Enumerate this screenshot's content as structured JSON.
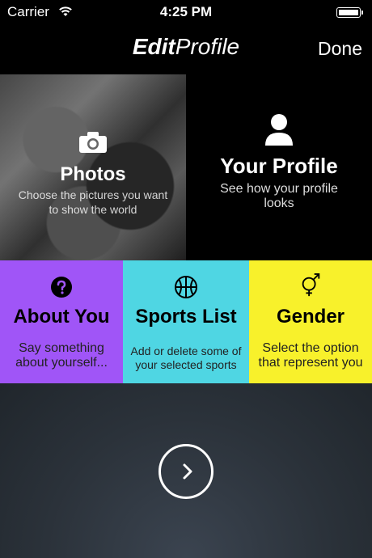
{
  "status_bar": {
    "carrier": "Carrier",
    "time": "4:25 PM",
    "wifi_icon": "wifi-icon",
    "battery_icon": "battery-icon"
  },
  "nav": {
    "title_bold": "Edit",
    "title_light": "Profile",
    "done_label": "Done"
  },
  "tiles": {
    "photos": {
      "title": "Photos",
      "description": "Choose the pictures you want to show the world",
      "icon": "camera-icon"
    },
    "profile": {
      "title": "Your Profile",
      "description": "See how your profile looks",
      "icon": "person-icon"
    },
    "about": {
      "title": "About You",
      "description": "Say something about yourself...",
      "icon": "question-icon",
      "color": "#a055f7"
    },
    "sports": {
      "title": "Sports List",
      "description": "Add or delete some of your selected sports",
      "icon": "basketball-icon",
      "color": "#4fd6e3"
    },
    "gender": {
      "title": "Gender",
      "description": "Select the option that represent you",
      "icon": "gender-icon",
      "color": "#f8f12b"
    }
  },
  "next": {
    "icon": "chevron-right-icon"
  }
}
